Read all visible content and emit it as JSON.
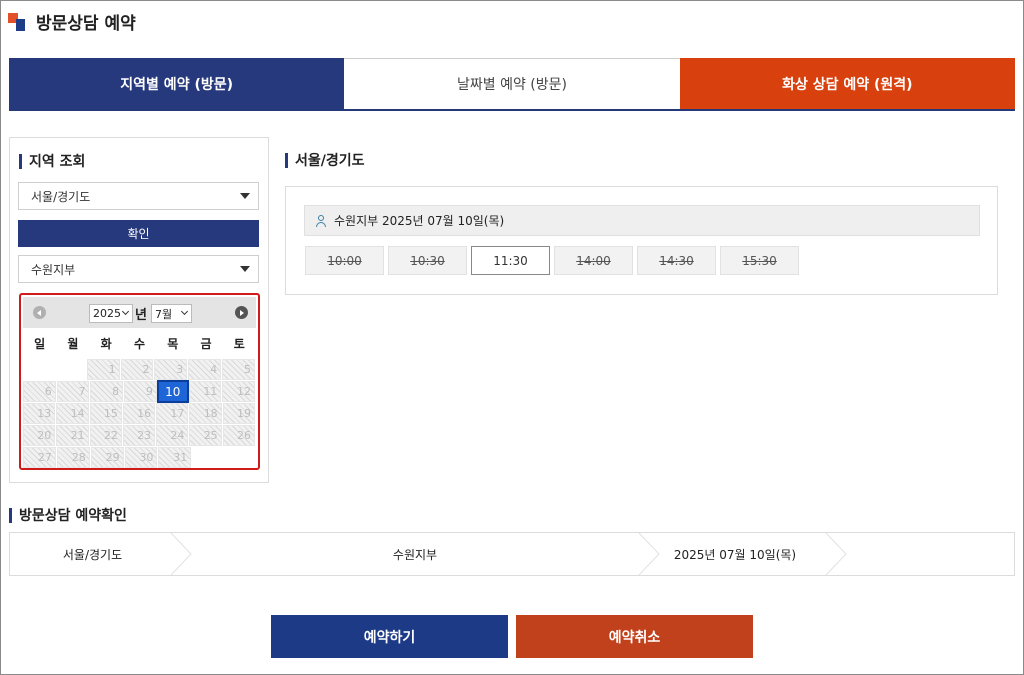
{
  "page": {
    "title": "방문상담 예약"
  },
  "tabs": [
    {
      "label": "지역별 예약 (방문)"
    },
    {
      "label": "날짜별 예약 (방문)"
    },
    {
      "label": "화상 상담 예약 (원격)"
    }
  ],
  "left": {
    "title": "지역 조회",
    "region_select": "서울/경기도",
    "confirm_label": "확인",
    "branch_select": "수원지부"
  },
  "calendar": {
    "year": "2025",
    "year_suffix": "년",
    "month": "7월",
    "dows": [
      "일",
      "월",
      "화",
      "수",
      "목",
      "금",
      "토"
    ],
    "weeks": [
      [
        "",
        "",
        "1",
        "2",
        "3",
        "4",
        "5"
      ],
      [
        "6",
        "7",
        "8",
        "9",
        "10",
        "11",
        "12"
      ],
      [
        "13",
        "14",
        "15",
        "16",
        "17",
        "18",
        "19"
      ],
      [
        "20",
        "21",
        "22",
        "23",
        "24",
        "25",
        "26"
      ],
      [
        "27",
        "28",
        "29",
        "30",
        "31",
        "",
        ""
      ]
    ],
    "selected_day": "10"
  },
  "slots_panel": {
    "region_title": "서울/경기도",
    "header": "수원지부 2025년 07월 10일(목)",
    "slots": [
      {
        "time": "10:00",
        "available": false
      },
      {
        "time": "10:30",
        "available": false
      },
      {
        "time": "11:30",
        "available": true
      },
      {
        "time": "14:00",
        "available": false
      },
      {
        "time": "14:30",
        "available": false
      },
      {
        "time": "15:30",
        "available": false
      }
    ]
  },
  "confirm": {
    "title": "방문상담 예약확인",
    "region": "서울/경기도",
    "branch": "수원지부",
    "date": "2025년 07월 10일(목)"
  },
  "actions": {
    "reserve": "예약하기",
    "cancel": "예약취소"
  },
  "colors": {
    "navy": "#27397d",
    "orange": "#d8400e",
    "calendar_border": "#d11a1a",
    "selected_day": "#1e66d8"
  }
}
